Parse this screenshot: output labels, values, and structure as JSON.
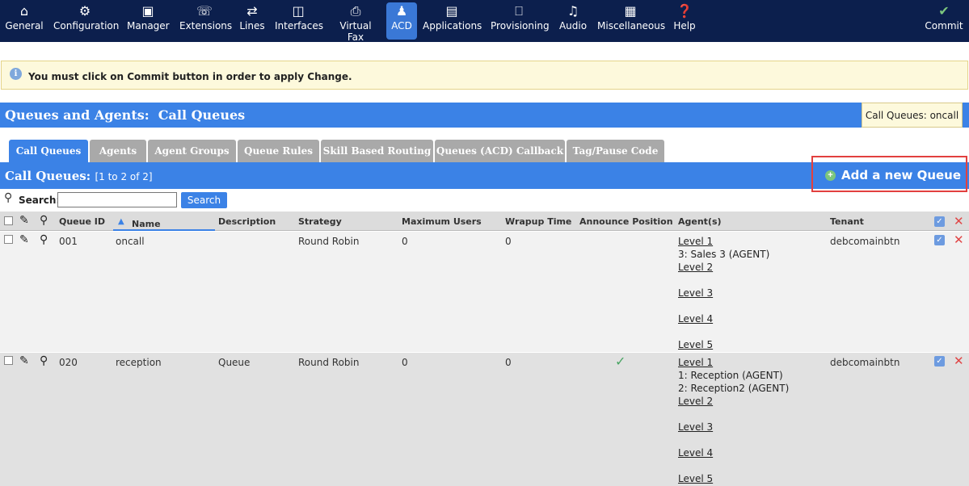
{
  "nav": {
    "items": [
      {
        "label": "General",
        "icon": "home-icon"
      },
      {
        "label": "Configuration",
        "icon": "gear-icon"
      },
      {
        "label": "Manager",
        "icon": "monitor-icon"
      },
      {
        "label": "Extensions",
        "icon": "phone-icon"
      },
      {
        "label": "Lines",
        "icon": "route-icon"
      },
      {
        "label": "Interfaces",
        "icon": "interface-icon"
      },
      {
        "label": "Virtual Fax",
        "icon": "fax-icon"
      },
      {
        "label": "ACD",
        "icon": "user-icon"
      },
      {
        "label": "Applications",
        "icon": "applications-icon"
      },
      {
        "label": "Provisioning",
        "icon": "provisioning-icon"
      },
      {
        "label": "Audio",
        "icon": "music-icon"
      },
      {
        "label": "Miscellaneous",
        "icon": "grid-icon"
      },
      {
        "label": "Help",
        "icon": "help-icon"
      }
    ],
    "commit": {
      "label": "Commit",
      "icon": "check-circle-icon"
    }
  },
  "notice": {
    "text": "You must click on Commit button in order to apply Change."
  },
  "header": {
    "title": "Queues and Agents:  Call Queues",
    "tooltip": "Call Queues: oncall"
  },
  "tabs": [
    "Call Queues",
    "Agents",
    "Agent Groups",
    "Queue Rules",
    "Skill Based Routing",
    "Queues (ACD) Callback",
    "Tag/Pause Code"
  ],
  "list": {
    "title": "Call Queues:",
    "count": "[1 to 2 of 2]",
    "add_label": "Add a new Queue"
  },
  "search": {
    "label": "Search:",
    "button": "Search",
    "value": ""
  },
  "columns": {
    "id": "Queue ID",
    "name": "Name",
    "description": "Description",
    "strategy": "Strategy",
    "max_users": "Maximum Users",
    "wrapup": "Wrapup Time",
    "announce": "Announce Position",
    "agents": "Agent(s)",
    "tenant": "Tenant"
  },
  "rows": [
    {
      "id": "001",
      "name": "oncall",
      "description": "",
      "strategy": "Round Robin",
      "max_users": "0",
      "wrapup": "0",
      "announce": false,
      "tenant": "debcomainbtn",
      "levels": [
        {
          "label": "Level 1",
          "agents": [
            "3: Sales 3 (AGENT)"
          ]
        },
        {
          "label": "Level 2",
          "agents": []
        },
        {
          "label": "Level 3",
          "agents": []
        },
        {
          "label": "Level 4",
          "agents": []
        },
        {
          "label": "Level 5",
          "agents": []
        }
      ]
    },
    {
      "id": "020",
      "name": "reception",
      "description": "Queue",
      "strategy": "Round Robin",
      "max_users": "0",
      "wrapup": "0",
      "announce": true,
      "tenant": "debcomainbtn",
      "levels": [
        {
          "label": "Level 1",
          "agents": [
            "1: Reception (AGENT)",
            "2: Reception2 (AGENT)"
          ]
        },
        {
          "label": "Level 2",
          "agents": []
        },
        {
          "label": "Level 3",
          "agents": []
        },
        {
          "label": "Level 4",
          "agents": []
        },
        {
          "label": "Level 5",
          "agents": []
        }
      ]
    }
  ]
}
